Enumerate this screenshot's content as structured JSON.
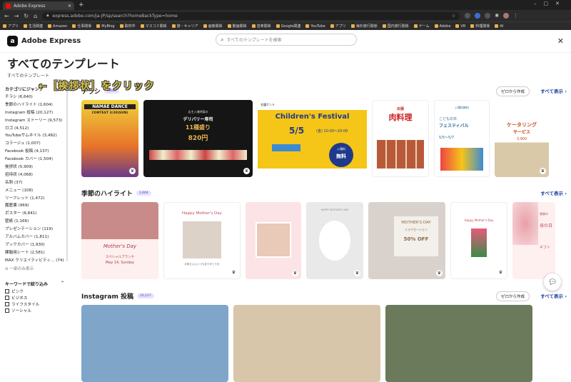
{
  "browser": {
    "tab_title": "Adobe Express",
    "url": "express.adobe.com/ja-JP/sp/search?homeBackType=home",
    "bookmarks": [
      "アプリ",
      "生活関連",
      "Amazon",
      "仕事関係",
      "MyBlog",
      "取材中",
      "マスコミ関係",
      "旅・キャリア",
      "画像関係",
      "動画関係",
      "音楽関係",
      "Google関連",
      "YouTube",
      "アプリ",
      "海外旅行関係",
      "国内旅行関係",
      "ゲーム",
      "Adobe",
      "VR",
      "料理関係",
      "AI"
    ]
  },
  "app": {
    "name": "Adobe Express",
    "search_placeholder": "すべてのテンプレートを検索"
  },
  "hero": {
    "title": "すべてのテンプレート",
    "breadcrumb": "すべてのテンプレート"
  },
  "sidebar": {
    "jump_title": "カテゴリにジャンプ",
    "categories": [
      "チラシ (6,640)",
      "季節のハイライト (1,604)",
      "Instagram 投稿 (20,127)",
      "Instagram ストーリー (9,573)",
      "ロゴ (4,512)",
      "YouTubeサムネイル (3,482)",
      "コラージュ (1,007)",
      "Facebook 投稿 (4,137)",
      "Facebook カバー (1,504)",
      "挨拶状 (5,909)",
      "招待状 (4,068)",
      "名刺 (37)",
      "メニュー (108)",
      "リーフレット (1,472)",
      "履歴書 (969)",
      "ポスター (6,841)",
      "壁紙 (1,166)",
      "プレゼンテーション (119)",
      "アルバムカバー (1,811)",
      "ブックカバー (1,930)",
      "課題用シート (2,581)",
      "MAX クリエイティビティ…  (74)"
    ],
    "less": "一部のみ表示",
    "keyword_title": "キーワードで絞り込み",
    "keywords": [
      "ピンク",
      "ビジネス",
      "ライフスタイル",
      "ソーシャル"
    ]
  },
  "annotation": "←［挨拶状］をクリック",
  "sections": [
    {
      "title": "チラシ",
      "count": "6,640",
      "zero": "ゼロから作成",
      "all": "すべて表示 ›"
    },
    {
      "title": "季節のハイライト",
      "count": "1,604",
      "all": "すべて表示 ›"
    },
    {
      "title": "Instagram 投稿",
      "count": "20,127",
      "zero": "ゼロから作成",
      "all": "すべて表示 ›"
    }
  ],
  "cards": {
    "dance": [
      "NAMAE DANCE",
      "CONTEST 3/20(SUN)"
    ],
    "sushi": [
      "店主入魂特製の",
      "デリバリー寿司",
      "11種盛り",
      "820円"
    ],
    "childrens": [
      "名護ケンド",
      "Children's Festival",
      "5/5",
      "(金) 10:00～20:00",
      "入場料",
      "無料"
    ],
    "niku": [
      "出張",
      "肉料理"
    ],
    "kodomo": [
      "入場料無料",
      "5/5",
      "こどもの日",
      "フェスティバル",
      "5/5～5/7"
    ],
    "catering": [
      "ケータリング",
      "サービス",
      "3,900"
    ],
    "mothers1": [
      "Mother's Day",
      "スペシャルブランチ",
      "May 14, Sunday"
    ],
    "mothers2": [
      "Happy Mother's Day",
      "お母さんにいつもありがとうを"
    ],
    "mothers4": [
      "HAPPY MOTHER'S DAY"
    ],
    "mothers5": [
      "MOTHER'S DAY",
      "リラクゼーション",
      "50% OFF"
    ],
    "mothers6": [
      "Happy Mother's Day"
    ],
    "mothers7": [
      "感謝の",
      "母の日",
      "ギフト"
    ]
  },
  "colors": {
    "accent": "#1a3a9c",
    "badge": "#e6e3ff",
    "yellow": "#f5c518",
    "annotation": "#d8c44a"
  }
}
